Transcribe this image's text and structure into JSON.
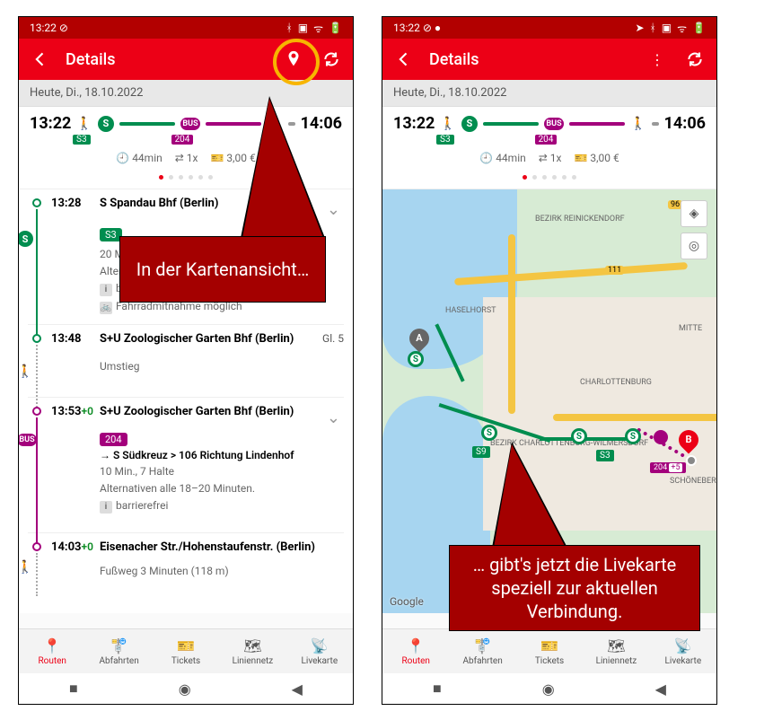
{
  "statusbar": {
    "time": "13:22"
  },
  "appbar": {
    "title": "Details"
  },
  "datebar": "Heute, Di., 18.10.2022",
  "summary": {
    "dep": "13:22",
    "arr": "14:06",
    "line1": "S3",
    "line2": "204",
    "duration": "44min",
    "transfers": "1x",
    "price": "3,00 €"
  },
  "itin": {
    "leg1": {
      "time": "13:28",
      "stop": "S Spandau Bhf (Berlin)",
      "tag": "S3",
      "meta1": "20 M",
      "meta2": "Alten",
      "barrier": "barrierefrei",
      "bike": "Fahrradmitnahme möglich"
    },
    "leg2": {
      "time": "13:48",
      "stop": "S+U Zoologischer Garten Bhf (Berlin)",
      "platform": "Gl. 5",
      "transfer": "Umstieg"
    },
    "leg3": {
      "time": "13:53",
      "delay": "+0",
      "stop": "S+U Zoologischer Garten Bhf (Berlin)",
      "tag": "204",
      "dir": "→ S Südkreuz > 106 Richtung Lindenhof",
      "meta1": "10 Min., 7 Halte",
      "meta2": "Alternativen alle 18–20 Minuten.",
      "barrier": "barrierefrei"
    },
    "leg4": {
      "time": "14:03",
      "delay": "+0",
      "stop": "Eisenacher Str./Hohenstaufenstr. (Berlin)",
      "foot": "Fußweg 3 Minuten (118 m)"
    }
  },
  "bottomnav": {
    "routen": "Routen",
    "abfahrten": "Abfahrten",
    "tickets": "Tickets",
    "liniennetz": "Liniennetz",
    "livekarte": "Livekarte"
  },
  "map": {
    "reinickendorf": "BEZIRK REINICKENDORF",
    "haselhorst": "HASELHORST",
    "charlottenburg": "CHARLOTTENBURG",
    "wilmersdorf": "BEZIRK CHARLOTTENBURG-WILMERSDORF",
    "schoeneberg": "SCHÖNEBERG",
    "mitte": "MITTE",
    "hwy111": "111",
    "hwy96": "96",
    "s3": "S3",
    "s9": "S9",
    "bus204": "204",
    "busdelay": "+5",
    "ptA": "A",
    "ptB": "B",
    "google": "Google"
  },
  "callout1": "In der Kartenansicht…",
  "callout2": "… gibt's jetzt die Livekarte speziell zur aktuellen Verbindung."
}
